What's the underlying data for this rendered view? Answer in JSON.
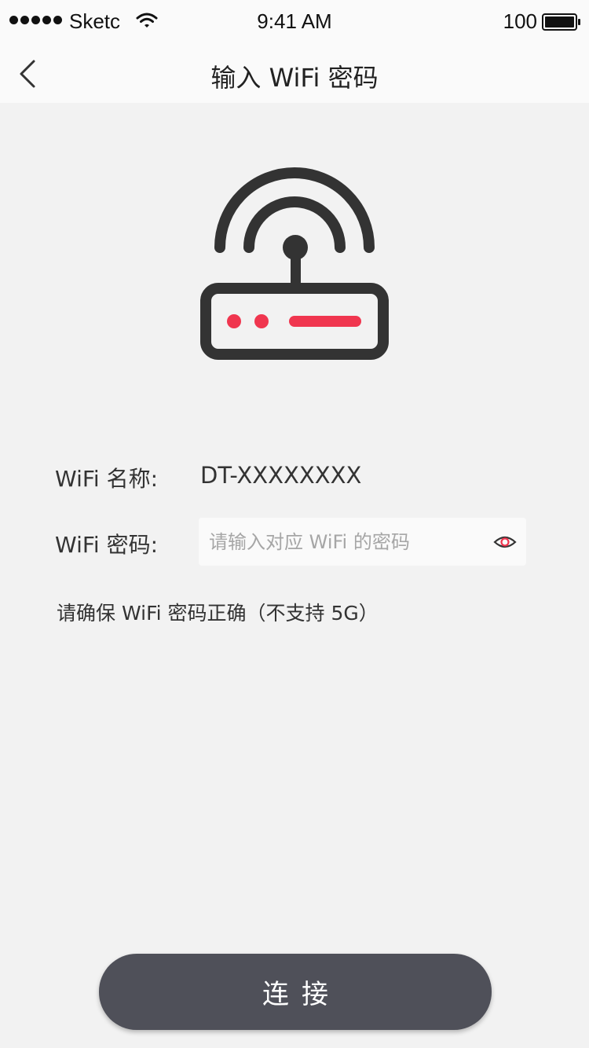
{
  "status_bar": {
    "carrier": "Sketc",
    "time": "9:41 AM",
    "battery_percent": "100",
    "battery_level": 1.0
  },
  "nav": {
    "back_icon": "chevron-left-icon",
    "title": "输入 WiFi 密码"
  },
  "illustration": {
    "icon": "router-icon",
    "accent_color": "#f0364f",
    "stroke_color": "#333333"
  },
  "form": {
    "name_label": "WiFi 名称:",
    "name_value": "DT-XXXXXXXX",
    "password_label": "WiFi 密码:",
    "password_value": "",
    "password_placeholder": "请输入对应 WiFi 的密码",
    "eye_icon": "eye-icon",
    "hint": "请确保 WiFi 密码正确（不支持 5G）"
  },
  "connect_button": {
    "label": "连接",
    "color": "#4f5059"
  }
}
